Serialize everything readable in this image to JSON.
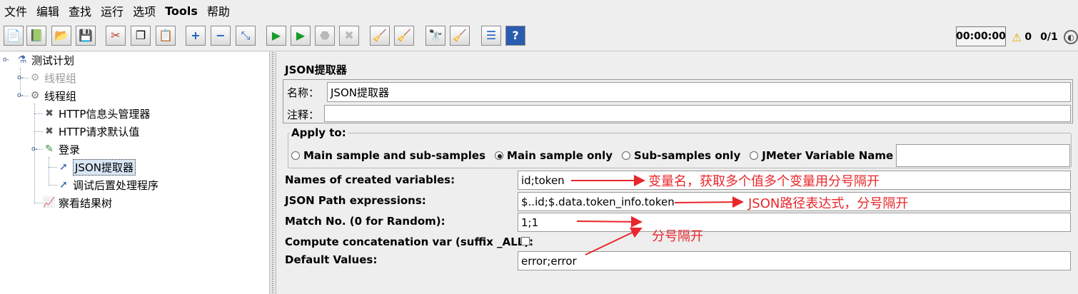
{
  "menu": [
    "文件",
    "编辑",
    "查找",
    "运行",
    "选项",
    "Tools",
    "帮助"
  ],
  "toolbar": {
    "icons": [
      "new-icon",
      "templates-icon",
      "open-icon",
      "save-icon",
      "cut-icon",
      "copy-icon",
      "paste-icon",
      "expand-icon",
      "collapse-icon",
      "toggle-icon",
      "start-icon",
      "start-no-pause-icon",
      "stop-icon",
      "shutdown-icon",
      "clear-icon",
      "clear-all-icon",
      "search-icon",
      "reset-search-icon",
      "function-helper-icon",
      "help-icon"
    ],
    "timer": "00:00:00",
    "warnings": "0",
    "threads": "0/1"
  },
  "tree": {
    "items": [
      {
        "label": "测试计划"
      },
      {
        "label": "线程组"
      },
      {
        "label": "线程组"
      },
      {
        "label": "HTTP信息头管理器"
      },
      {
        "label": "HTTP请求默认值"
      },
      {
        "label": "登录"
      },
      {
        "label": "JSON提取器"
      },
      {
        "label": "调试后置处理程序"
      },
      {
        "label": "察看结果树"
      }
    ]
  },
  "panel": {
    "title": "JSON提取器",
    "name_label": "名称：",
    "name_value": "JSON提取器",
    "comment_label": "注释：",
    "comment_value": "",
    "apply_to": {
      "legend": "Apply to:",
      "options": [
        "Main sample and sub-samples",
        "Main sample only",
        "Sub-samples only",
        "JMeter Variable Name to use"
      ],
      "selected": "Main sample only",
      "var_name_value": ""
    },
    "fields": {
      "names_label": "Names of created variables:",
      "names_value": "id;token",
      "json_path_label": "JSON Path expressions:",
      "json_path_value": "$..id;$.data.token_info.token",
      "match_no_label": "Match No. (0 for Random):",
      "match_no_value": "1;1",
      "concat_label": "Compute concatenation var (suffix _ALL):",
      "concat_checked": false,
      "default_label": "Default Values:",
      "default_value": "error;error"
    }
  },
  "annotations": {
    "names_note": "变量名，获取多个值多个变量用分号隔开",
    "json_path_note": "JSON路径表达式，分号隔开",
    "match_note": "分号隔开",
    "color": "#e8262b"
  }
}
